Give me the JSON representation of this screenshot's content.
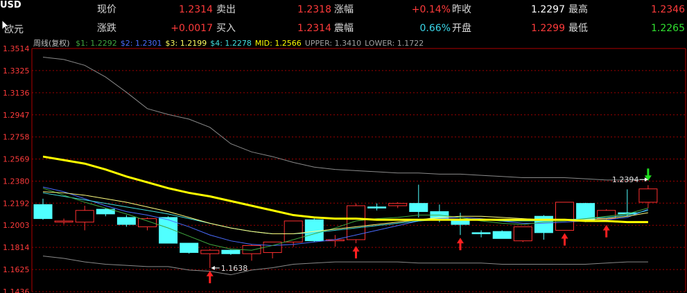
{
  "quote": {
    "symbol": "USD",
    "symbol2": "欧元",
    "rows": [
      [
        {
          "label": "现价",
          "value": "1.2314",
          "color": "red"
        },
        {
          "label": "卖出",
          "value": "1.2318",
          "color": "red"
        },
        {
          "label": "涨幅",
          "value": "+0.14%",
          "color": "red"
        },
        {
          "label": "昨收",
          "value": "1.2297",
          "color": "white"
        },
        {
          "label": "最高",
          "value": "1.2346",
          "color": "red"
        }
      ],
      [
        {
          "label": "涨跌",
          "value": "+0.0017",
          "color": "red"
        },
        {
          "label": "买入",
          "value": "1.2314",
          "color": "red"
        },
        {
          "label": "震幅",
          "value": "0.66%",
          "color": "cyan"
        },
        {
          "label": "开盘",
          "value": "1.2299",
          "color": "red"
        },
        {
          "label": "最低",
          "value": "1.2265",
          "color": "green"
        }
      ]
    ]
  },
  "legend": {
    "period": "周线(复权)",
    "items": [
      {
        "text": "$1: 1.2292",
        "color": "#3fa63f"
      },
      {
        "text": "$2: 1.2301",
        "color": "#4a6cff"
      },
      {
        "text": "$3: 1.2199",
        "color": "#ffff60"
      },
      {
        "text": "$4: 1.2278",
        "color": "#40e0e0"
      },
      {
        "text": "MID: 1.2566",
        "color": "#ffff00"
      },
      {
        "text": "UPPER: 1.3410",
        "color": "#a0a0a0"
      },
      {
        "text": "LOWER: 1.1722",
        "color": "#a0a0a0"
      }
    ]
  },
  "chart_data": {
    "type": "candlestick",
    "ylim": [
      1.1436,
      1.3514
    ],
    "y_ticks": [
      "1.3514",
      "1.3325",
      "1.3136",
      "1.2947",
      "1.2758",
      "1.2569",
      "1.2380",
      "1.2192",
      "1.2003",
      "1.1814",
      "1.1625",
      "1.1436"
    ],
    "candles": [
      {
        "o": 1.218,
        "h": 1.223,
        "l": 1.205,
        "c": 1.206
      },
      {
        "o": 1.203,
        "h": 1.206,
        "l": 1.201,
        "c": 1.204
      },
      {
        "o": 1.203,
        "h": 1.217,
        "l": 1.196,
        "c": 1.213
      },
      {
        "o": 1.214,
        "h": 1.215,
        "l": 1.208,
        "c": 1.21
      },
      {
        "o": 1.207,
        "h": 1.209,
        "l": 1.199,
        "c": 1.201
      },
      {
        "o": 1.199,
        "h": 1.207,
        "l": 1.196,
        "c": 1.206
      },
      {
        "o": 1.207,
        "h": 1.208,
        "l": 1.185,
        "c": 1.185
      },
      {
        "o": 1.185,
        "h": 1.185,
        "l": 1.176,
        "c": 1.177
      },
      {
        "o": 1.176,
        "h": 1.18,
        "l": 1.1638,
        "c": 1.179
      },
      {
        "o": 1.179,
        "h": 1.1795,
        "l": 1.175,
        "c": 1.176
      },
      {
        "o": 1.176,
        "h": 1.184,
        "l": 1.17,
        "c": 1.183
      },
      {
        "o": 1.177,
        "h": 1.186,
        "l": 1.172,
        "c": 1.186
      },
      {
        "o": 1.186,
        "h": 1.204,
        "l": 1.182,
        "c": 1.204
      },
      {
        "o": 1.205,
        "h": 1.206,
        "l": 1.186,
        "c": 1.187
      },
      {
        "o": 1.187,
        "h": 1.192,
        "l": 1.182,
        "c": 1.188
      },
      {
        "o": 1.188,
        "h": 1.219,
        "l": 1.185,
        "c": 1.217
      },
      {
        "o": 1.216,
        "h": 1.219,
        "l": 1.213,
        "c": 1.215
      },
      {
        "o": 1.217,
        "h": 1.22,
        "l": 1.215,
        "c": 1.219
      },
      {
        "o": 1.219,
        "h": 1.235,
        "l": 1.207,
        "c": 1.212
      },
      {
        "o": 1.212,
        "h": 1.218,
        "l": 1.203,
        "c": 1.206
      },
      {
        "o": 1.205,
        "h": 1.211,
        "l": 1.192,
        "c": 1.201
      },
      {
        "o": 1.194,
        "h": 1.196,
        "l": 1.19,
        "c": 1.193
      },
      {
        "o": 1.195,
        "h": 1.196,
        "l": 1.189,
        "c": 1.189
      },
      {
        "o": 1.187,
        "h": 1.199,
        "l": 1.186,
        "c": 1.199
      },
      {
        "o": 1.208,
        "h": 1.209,
        "l": 1.188,
        "c": 1.194
      },
      {
        "o": 1.196,
        "h": 1.218,
        "l": 1.196,
        "c": 1.22
      },
      {
        "o": 1.219,
        "h": 1.2195,
        "l": 1.203,
        "c": 1.204
      },
      {
        "o": 1.206,
        "h": 1.214,
        "l": 1.203,
        "c": 1.213
      },
      {
        "o": 1.211,
        "h": 1.231,
        "l": 1.208,
        "c": 1.21
      },
      {
        "o": 1.22,
        "h": 1.2346,
        "l": 1.215,
        "c": 1.2314
      }
    ],
    "ma1": [
      1.232,
      1.226,
      1.22,
      1.215,
      1.21,
      1.204,
      1.198,
      1.191,
      1.184,
      1.18,
      1.179,
      1.183,
      1.188,
      1.193,
      1.198,
      1.204,
      1.206,
      1.207,
      1.209,
      1.209,
      1.207,
      1.204,
      1.202,
      1.201,
      1.203,
      1.204,
      1.206,
      1.208,
      1.21,
      1.215
    ],
    "ma2": [
      1.233,
      1.229,
      1.223,
      1.217,
      1.212,
      1.209,
      1.205,
      1.199,
      1.192,
      1.187,
      1.184,
      1.183,
      1.184,
      1.186,
      1.188,
      1.192,
      1.196,
      1.2,
      1.204,
      1.206,
      1.207,
      1.206,
      1.204,
      1.202,
      1.202,
      1.203,
      1.204,
      1.205,
      1.207,
      1.214
    ],
    "ma3": [
      1.229,
      1.228,
      1.226,
      1.223,
      1.22,
      1.216,
      1.212,
      1.207,
      1.202,
      1.198,
      1.195,
      1.193,
      1.193,
      1.195,
      1.197,
      1.199,
      1.201,
      1.203,
      1.205,
      1.207,
      1.208,
      1.208,
      1.207,
      1.206,
      1.205,
      1.205,
      1.205,
      1.206,
      1.208,
      1.211
    ],
    "ma4": [
      1.228,
      1.225,
      1.222,
      1.219,
      1.216,
      1.213,
      1.21,
      1.206,
      1.202,
      1.198,
      1.195,
      1.193,
      1.193,
      1.194,
      1.196,
      1.198,
      1.2,
      1.202,
      1.204,
      1.205,
      1.205,
      1.205,
      1.204,
      1.204,
      1.204,
      1.205,
      1.206,
      1.207,
      1.209,
      1.213
    ],
    "mid": [
      1.259,
      1.256,
      1.253,
      1.248,
      1.242,
      1.237,
      1.232,
      1.228,
      1.225,
      1.221,
      1.217,
      1.213,
      1.209,
      1.207,
      1.206,
      1.206,
      1.205,
      1.205,
      1.205,
      1.205,
      1.205,
      1.205,
      1.205,
      1.205,
      1.205,
      1.205,
      1.204,
      1.204,
      1.203,
      1.203
    ],
    "upper": [
      1.344,
      1.342,
      1.337,
      1.327,
      1.314,
      1.3,
      1.295,
      1.291,
      1.284,
      1.27,
      1.263,
      1.259,
      1.254,
      1.25,
      1.248,
      1.247,
      1.246,
      1.245,
      1.245,
      1.244,
      1.244,
      1.243,
      1.242,
      1.241,
      1.241,
      1.241,
      1.24,
      1.239,
      1.239,
      1.2394
    ],
    "lower": [
      1.174,
      1.172,
      1.169,
      1.167,
      1.166,
      1.165,
      1.165,
      1.162,
      1.161,
      1.158,
      1.162,
      1.164,
      1.167,
      1.168,
      1.169,
      1.169,
      1.169,
      1.169,
      1.168,
      1.168,
      1.168,
      1.168,
      1.167,
      1.167,
      1.167,
      1.167,
      1.167,
      1.168,
      1.169,
      1.169
    ],
    "annotations": [
      {
        "text": "1.1638",
        "candle": 8,
        "value": 1.1638
      },
      {
        "text": "1.2394",
        "candle": 29,
        "value": 1.2394
      }
    ],
    "up_arrows": [
      8,
      15,
      20,
      25,
      27
    ],
    "down_arrows": [
      29
    ]
  }
}
